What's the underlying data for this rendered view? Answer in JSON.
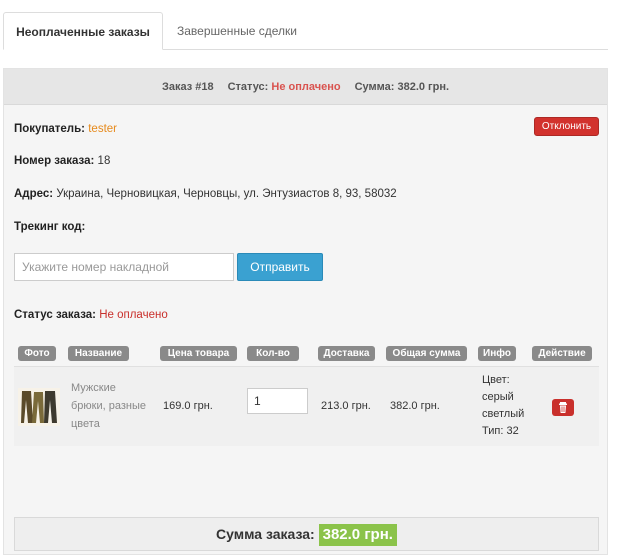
{
  "tabs": {
    "active": "Неоплаченные заказы",
    "inactive": "Завершенные сделки"
  },
  "order_header": {
    "order": "Заказ #18",
    "status_label": "Статус:",
    "status_value": "Не оплачено",
    "sum": "Сумма: 382.0 грн."
  },
  "buyer": {
    "label": "Покупатель:",
    "value": "tester"
  },
  "decline_label": "Отклонить",
  "order_number": {
    "label": "Номер заказа:",
    "value": "18"
  },
  "address": {
    "label": "Адрес:",
    "value": "Украина, Черновицкая, Черновцы, ул. Энтузиастов 8, 93, 58032"
  },
  "tracking": {
    "label": "Трекинг код:",
    "placeholder": "Укажите номер накладной",
    "send_label": "Отправить"
  },
  "order_status": {
    "label": "Статус заказа:",
    "value": "Не оплачено"
  },
  "table": {
    "headers": [
      "Фото",
      "Название",
      "Цена товара",
      "Кол-во",
      "Доставка",
      "Общая сумма",
      "Инфо",
      "Действие"
    ],
    "row": {
      "name_line1": "Мужские",
      "name_line2": "брюки, разные",
      "name_line3": "цвета",
      "price": "169.0 грн.",
      "qty": "1",
      "delivery": "213.0 грн.",
      "total": "382.0 грн.",
      "info_line1": "Цвет:",
      "info_line2": "серый",
      "info_line3": "светлый",
      "info_line4": "Тип: 32"
    }
  },
  "total": {
    "label": "Сумма заказа:",
    "value": "382.0 грн."
  },
  "icons": {
    "delete": "trash-icon",
    "photo": "pants-photo"
  },
  "colors": {
    "danger": "#d2322d",
    "primary": "#3aa1d1",
    "success": "#8bc34a",
    "accent_text": "#e68a1c"
  }
}
